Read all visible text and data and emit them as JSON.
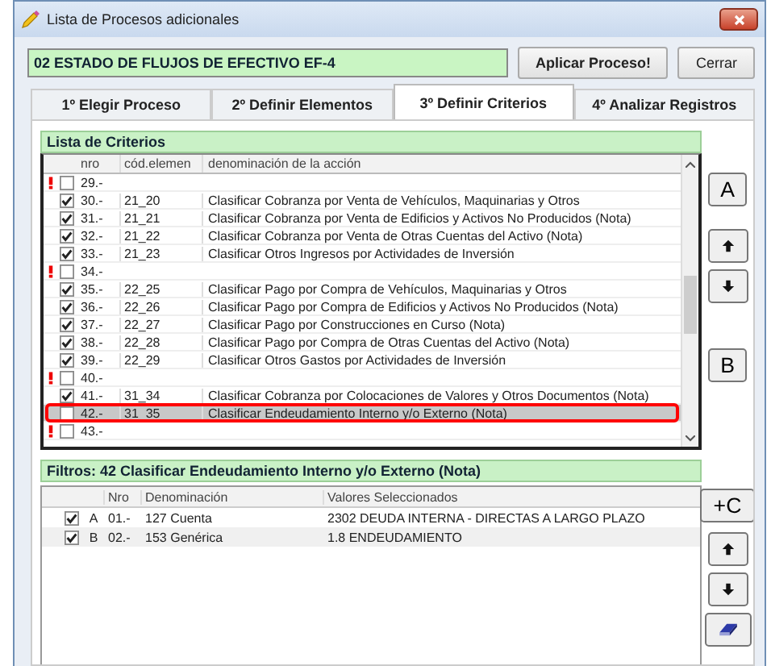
{
  "window": {
    "title": "Lista de Procesos adicionales"
  },
  "process_field": {
    "value": "02 ESTADO DE FLUJOS DE EFECTIVO EF-4"
  },
  "buttons": [
    "Aplicar Proceso!",
    "Cerrar"
  ],
  "tabs": [
    {
      "label": "1º Elegir Proceso",
      "selected": false
    },
    {
      "label": "2º Definir Elementos",
      "selected": false
    },
    {
      "label": "3º Definir Criterios",
      "selected": true
    },
    {
      "label": "4º Analizar Registros",
      "selected": false
    }
  ],
  "criteria": {
    "title": "Lista de Criterios",
    "columns": [
      "nro",
      "cód.elemen",
      "denominación de la acción"
    ],
    "rows": [
      {
        "warning": true,
        "checked": false,
        "selected": false,
        "nro": "29.-"
      },
      {
        "warning": false,
        "checked": true,
        "selected": false,
        "nro": "30.-",
        "code": "21_20",
        "action": "Clasificar Cobranza por Venta de Vehículos, Maquinarias y Otros"
      },
      {
        "warning": false,
        "checked": true,
        "selected": false,
        "nro": "31.-",
        "code": "21_21",
        "action": "Clasificar Cobranza por Venta de Edificios y Activos No Producidos (Nota)"
      },
      {
        "warning": false,
        "checked": true,
        "selected": false,
        "nro": "32.-",
        "code": "21_22",
        "action": "Clasificar Cobranza por Venta de Otras Cuentas del Activo (Nota)"
      },
      {
        "warning": false,
        "checked": true,
        "selected": false,
        "nro": "33.-",
        "code": "21_23",
        "action": "Clasificar Otros Ingresos por Actividades de Inversión"
      },
      {
        "warning": true,
        "checked": false,
        "selected": false,
        "nro": "34.-"
      },
      {
        "warning": false,
        "checked": true,
        "selected": false,
        "nro": "35.-",
        "code": "22_25",
        "action": "Clasificar Pago por Compra de Vehículos, Maquinarias y Otros"
      },
      {
        "warning": false,
        "checked": true,
        "selected": false,
        "nro": "36.-",
        "code": "22_26",
        "action": "Clasificar Pago por Compra de Edificios y Activos No Producidos (Nota)"
      },
      {
        "warning": false,
        "checked": true,
        "selected": false,
        "nro": "37.-",
        "code": "22_27",
        "action": "Clasificar Pago por Construcciones en Curso (Nota)"
      },
      {
        "warning": false,
        "checked": true,
        "selected": false,
        "nro": "38.-",
        "code": "22_28",
        "action": "Clasificar Pago por Compra de Otras Cuentas del Activo (Nota)"
      },
      {
        "warning": false,
        "checked": true,
        "selected": false,
        "nro": "39.-",
        "code": "22_29",
        "action": "Clasificar Otros Gastos por Actividades de Inversión"
      },
      {
        "warning": true,
        "checked": false,
        "selected": false,
        "nro": "40.-"
      },
      {
        "warning": false,
        "checked": true,
        "selected": false,
        "nro": "41.-",
        "code": "31_34",
        "action": "Clasificar Cobranza por Colocaciones de Valores y Otros Documentos (Nota)"
      },
      {
        "warning": false,
        "checked": false,
        "selected": true,
        "nro": "42.-",
        "code": "31_35",
        "action": "Clasificar Endeudamiento Interno y/o Externo (Nota)"
      },
      {
        "warning": true,
        "checked": false,
        "selected": false,
        "nro": "43.-"
      }
    ]
  },
  "criteria_side_buttons": [
    "A",
    "B"
  ],
  "filters": {
    "title": "Filtros: 42 Clasificar Endeudamiento Interno y/o Externo (Nota)",
    "columns": [
      "Nro",
      "Denominación",
      "Valores Seleccionados"
    ],
    "rows": [
      {
        "checked": true,
        "letter": "A",
        "nro": "01.-",
        "code": "127",
        "name": "Cuenta",
        "values": "2302 DEUDA INTERNA - DIRECTAS A LARGO PLAZO"
      },
      {
        "checked": true,
        "letter": "B",
        "nro": "02.-",
        "code": "153",
        "name": "Genérica",
        "values": "1.8 ENDEUDAMIENTO"
      }
    ]
  },
  "filters_side_buttons": [
    "+C"
  ]
}
